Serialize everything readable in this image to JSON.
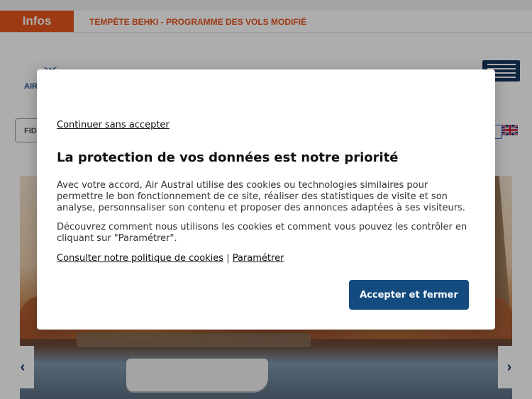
{
  "infobar": {
    "tab_label": "Infos",
    "message": "TEMPÊTE BEHKI - PROGRAMME DES VOLS MODIFIÉ"
  },
  "header": {
    "logo_text": "AIR",
    "search_placeholder": "FID"
  },
  "hero": {
    "prev_arrow": "‹",
    "next_arrow": "›"
  },
  "consent": {
    "continue_link": "Continuer sans accepter",
    "title": "La protection de vos données est notre priorité",
    "paragraph1": "Avec votre accord, Air Austral utilise des cookies ou technologies similaires pour permettre le bon fonctionnement de ce site, réaliser des statistiques de visite et son analyse, personnsaliser son contenu et proposer des annonces adaptées à ses visiteurs.",
    "paragraph2": "Découvrez comment nous utilisons les cookies et comment vous pouvez les contrôler en cliquant sur \"Paramétrer\".",
    "policy_link": "Consulter notre politique de cookies",
    "separator": "|",
    "settings_link": "Paramétrer",
    "accept_button": "Accepter et fermer"
  },
  "colors": {
    "accent_orange": "#e8541c",
    "brand_navy": "#134b7f"
  }
}
